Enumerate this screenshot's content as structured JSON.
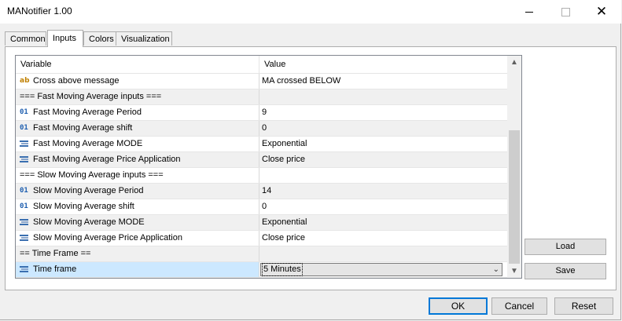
{
  "window": {
    "title": "MANotifier 1.00"
  },
  "tabs": [
    "Common",
    "Inputs",
    "Colors",
    "Visualization"
  ],
  "grid": {
    "headers": {
      "variable": "Variable",
      "value": "Value"
    },
    "rows": [
      {
        "icon": "ab",
        "variable": "Cross above message",
        "value": "MA crossed BELOW"
      },
      {
        "icon": "",
        "variable": "=== Fast Moving Average inputs ===",
        "value": ""
      },
      {
        "icon": "01",
        "variable": "Fast Moving Average Period",
        "value": "9"
      },
      {
        "icon": "01",
        "variable": "Fast Moving Average shift",
        "value": "0"
      },
      {
        "icon": "enum",
        "variable": "Fast Moving Average MODE",
        "value": "Exponential"
      },
      {
        "icon": "enum",
        "variable": "Fast Moving Average Price Application",
        "value": "Close price"
      },
      {
        "icon": "",
        "variable": "=== Slow Moving Average inputs ===",
        "value": ""
      },
      {
        "icon": "01",
        "variable": "Slow Moving Average Period",
        "value": "14"
      },
      {
        "icon": "01",
        "variable": "Slow Moving Average shift",
        "value": "0"
      },
      {
        "icon": "enum",
        "variable": "Slow Moving Average MODE",
        "value": "Exponential"
      },
      {
        "icon": "enum",
        "variable": "Slow Moving Average Price Application",
        "value": "Close price"
      },
      {
        "icon": "",
        "variable": "== Time Frame ==",
        "value": ""
      },
      {
        "icon": "enum",
        "variable": "Time frame",
        "value": "5 Minutes"
      }
    ]
  },
  "side_buttons": {
    "load": "Load",
    "save": "Save"
  },
  "dialog_buttons": {
    "ok": "OK",
    "cancel": "Cancel",
    "reset": "Reset"
  },
  "icons": {
    "min": "minimize-icon",
    "max": "maximize-icon",
    "close": "close-icon"
  }
}
